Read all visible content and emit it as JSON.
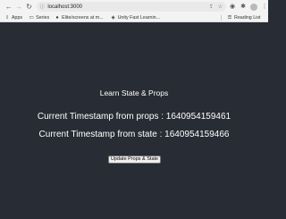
{
  "browser": {
    "url": "localhost:3000",
    "bookmarks": [
      {
        "label": "Apps",
        "icon": "apps-grid-icon"
      },
      {
        "label": "Series",
        "icon": "folder-icon"
      },
      {
        "label": "Elite/screens at m...",
        "icon": "github-icon"
      },
      {
        "label": "Unity Fast Learnin...",
        "icon": "unity-icon"
      }
    ],
    "reading_list": "Reading List"
  },
  "app": {
    "title": "Learn State & Props",
    "props_line": "Current Timestamp from props : 1640954159461",
    "state_line": "Current Timestamp from state : 1640954159466",
    "button_label": "Update Props & State",
    "background": "#282c34",
    "text_color": "#ffffff"
  }
}
